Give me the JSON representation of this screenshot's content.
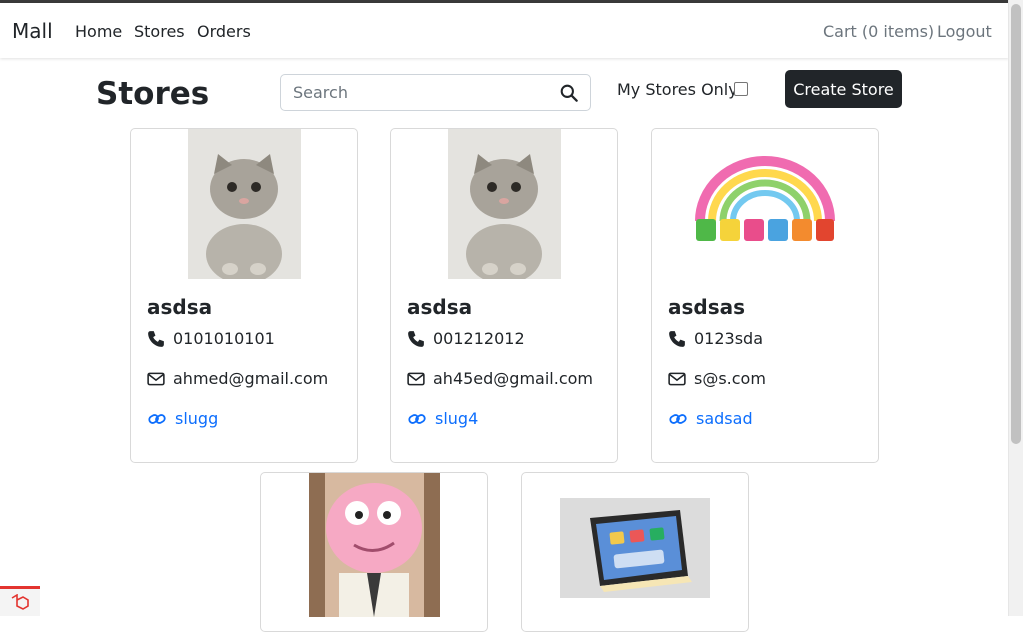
{
  "navbar": {
    "brand": "Mall",
    "links": [
      "Home",
      "Stores",
      "Orders"
    ],
    "cart": "Cart (0 items)",
    "logout": "Logout"
  },
  "page": {
    "title": "Stores",
    "search_placeholder": "Search",
    "my_stores_label": "My Stores Only",
    "my_stores_checked": false,
    "create_button": "Create Store"
  },
  "stores": [
    {
      "name": "asdsa",
      "phone": "0101010101",
      "email": "ahmed@gmail.com",
      "slug": "slugg",
      "image": "kitten-photo"
    },
    {
      "name": "asdsa",
      "phone": "001212012",
      "email": "ah45ed@gmail.com",
      "slug": "slug4",
      "image": "kitten-photo"
    },
    {
      "name": "asdsas",
      "phone": "0123sda",
      "email": "s@s.com",
      "slug": "sadsad",
      "image": "gumball-logo"
    },
    {
      "name": "",
      "phone": "",
      "email": "",
      "slug": "",
      "image": "cartoon-character"
    },
    {
      "name": "",
      "phone": "",
      "email": "",
      "slug": "",
      "image": "tablet-photo"
    }
  ],
  "colors": {
    "link": "#0d6efd",
    "button_dark": "#212529",
    "laravel_red": "#e3342f"
  }
}
